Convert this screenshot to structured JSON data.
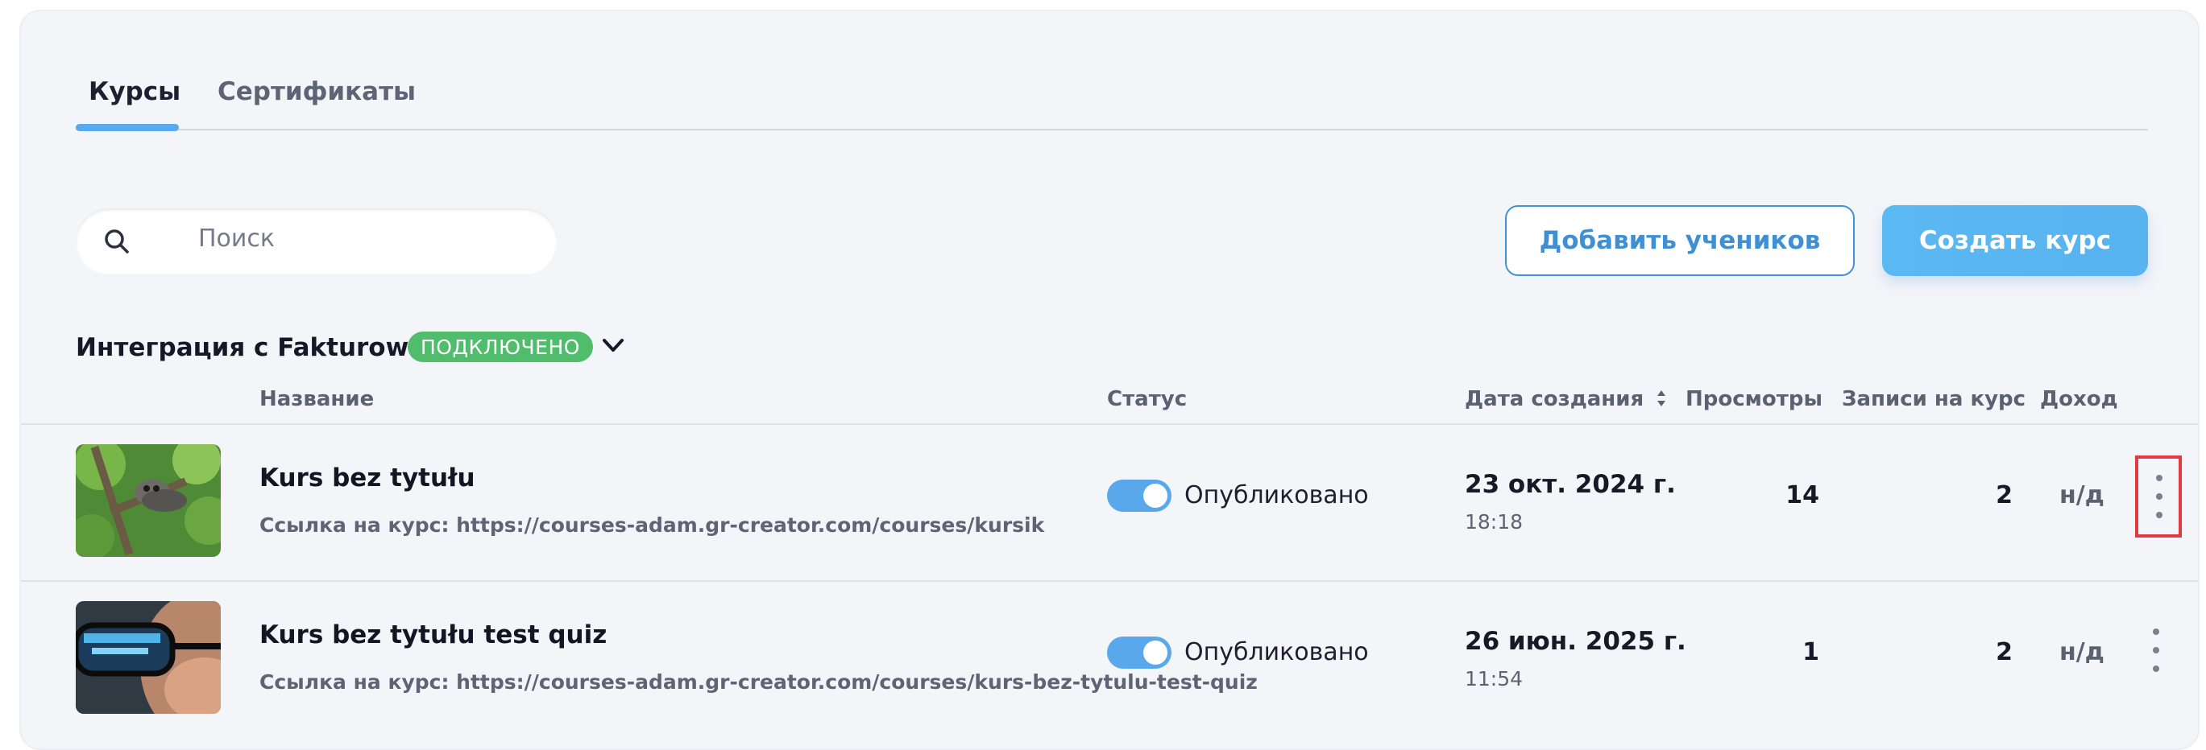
{
  "tabs": [
    {
      "label": "Курсы",
      "active": true
    },
    {
      "label": "Сертификаты",
      "active": false
    }
  ],
  "search": {
    "placeholder": "Поиск",
    "icon": "search-icon"
  },
  "buttons": {
    "add_students": "Добавить учеников",
    "create_course": "Создать курс"
  },
  "integration": {
    "title": "Интеграция с Fakturownia",
    "badge": "ПОДКЛЮЧЕНО",
    "badge_color": "#4fbd6c"
  },
  "table": {
    "headers": {
      "name": "Название",
      "status": "Статус",
      "created": "Дата создания",
      "views": "Просмотры",
      "enrollments": "Записи на курс",
      "income": "Доход"
    },
    "rows": [
      {
        "title": "Kurs bez tytułu",
        "link": "Ссылка на курс: https://courses-adam.gr-creator.com/courses/kursik",
        "status": "Опубликовано",
        "published": true,
        "date": "23 окт. 2024 г.",
        "time": "18:18",
        "views": "14",
        "enrollments": "2",
        "income": "н/д"
      },
      {
        "title": "Kurs bez tytułu test quiz",
        "link": "Ссылка на курс: https://courses-adam.gr-creator.com/courses/kurs-bez-tytulu-test-quiz",
        "status": "Опубликовано",
        "published": true,
        "date": "26 июн. 2025 г.",
        "time": "11:54",
        "views": "1",
        "enrollments": "2",
        "income": "н/д"
      }
    ]
  },
  "colors": {
    "accent": "#59a8ec",
    "primary_button": "#58b3ef",
    "highlight": "#e03a43"
  }
}
